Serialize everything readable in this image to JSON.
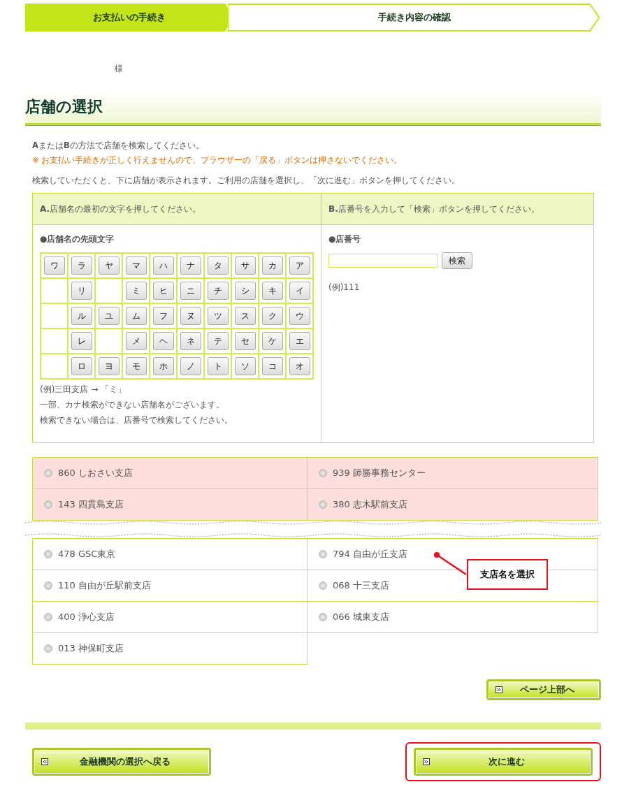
{
  "steps": [
    {
      "label": "お支払いの手続き",
      "selected": true
    },
    {
      "label": "手続き内容の確認",
      "selected": false
    }
  ],
  "customer_suffix": "様",
  "heading": "店舗の選択",
  "instructions": [
    {
      "kind": "normal",
      "text": "**A**または**B**の方法で店舗を検索してください。"
    },
    {
      "kind": "warning",
      "text": "※ お支払い手続きが正しく行えませんので、ブラウザーの「戻る」ボタンは押さないでください。"
    },
    {
      "kind": "normal",
      "text": "検索していただくと、下に店舗が表示されます。ご利用の店舗を選択し、「次に進む」ボタンを押してください。"
    }
  ],
  "search_a": {
    "header": "**A.**店舗名の最初の文字を押してください。",
    "title": "●店舗名の先頭文字",
    "kana_rows": [
      [
        "ワ",
        "ラ",
        "ヤ",
        "マ",
        "ハ",
        "ナ",
        "タ",
        "サ",
        "カ",
        "ア"
      ],
      [
        null,
        "リ",
        null,
        "ミ",
        "ヒ",
        "ニ",
        "チ",
        "シ",
        "キ",
        "イ"
      ],
      [
        null,
        "ル",
        "ユ",
        "ム",
        "フ",
        "ヌ",
        "ツ",
        "ス",
        "ク",
        "ウ"
      ],
      [
        null,
        "レ",
        null,
        "メ",
        "ヘ",
        "ネ",
        "テ",
        "セ",
        "ケ",
        "エ"
      ],
      [
        null,
        "ロ",
        "ヨ",
        "モ",
        "ホ",
        "ノ",
        "ト",
        "ソ",
        "コ",
        "オ"
      ]
    ],
    "notes": [
      "(例)三田支店 → 「ミ」",
      "一部、カナ検索ができない店舗名がございます。",
      "検索できない場合は、店番号で検索してください。"
    ]
  },
  "search_b": {
    "header": "**B.**店番号を入力して「検索」ボタンを押してください。",
    "title": "●店番号",
    "search_button": "検索",
    "example": "(例)111"
  },
  "branches": [
    {
      "label": "860 しおさい支店",
      "highlighted": true,
      "selected": false
    },
    {
      "label": "939 師勝事務センター",
      "highlighted": true,
      "selected": false
    },
    {
      "label": "143 四貫島支店",
      "highlighted": true,
      "selected": false
    },
    {
      "label": "380 志木駅前支店",
      "highlighted": true,
      "selected": false
    },
    {
      "label": "478 GSC東京",
      "highlighted": false,
      "selected": false
    },
    {
      "label": "794 自由が丘支店",
      "highlighted": false,
      "selected": false
    },
    {
      "label": "110 自由が丘駅前支店",
      "highlighted": false,
      "selected": false
    },
    {
      "label": "068 十三支店",
      "highlighted": false,
      "selected": false
    },
    {
      "label": "400 浄心支店",
      "highlighted": false,
      "selected": false
    },
    {
      "label": "066 城東支店",
      "highlighted": false,
      "selected": false
    },
    {
      "label": "013 神保町支店",
      "highlighted": false,
      "selected": false
    }
  ],
  "callout": "支店名を選択",
  "page_top_button": "ページ上部へ",
  "back_button": "金融機関の選択へ戻る",
  "next_button": {
    "label": "次に進む",
    "annotated": true
  }
}
